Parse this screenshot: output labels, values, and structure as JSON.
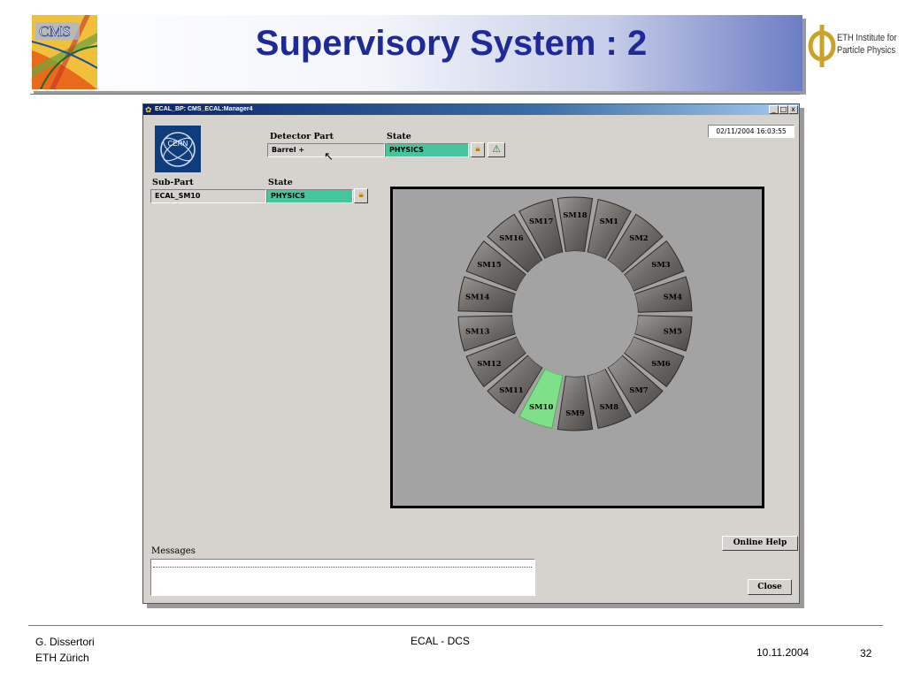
{
  "slide": {
    "title": "Supervisory System : 2",
    "cms_logo_text": "CMS",
    "eth_logo_line1": "ETH Institute for",
    "eth_logo_line2": "Particle Physics"
  },
  "window": {
    "title": "ECAL_BP: CMS_ECAL:Manager4",
    "controls": [
      "_",
      "□",
      "x"
    ],
    "cern_logo_text": "CERN",
    "datetime": "02/11/2004  16:03:55",
    "detector_part": {
      "label": "Detector Part",
      "value": "Barrel +"
    },
    "detector_state": {
      "label": "State",
      "value": "PHYSICS",
      "color": "#44c79e"
    },
    "subpart": {
      "label": "Sub-Part",
      "value": "ECAL_SM10"
    },
    "subpart_state": {
      "label": "State",
      "value": "PHYSICS",
      "color": "#44c79e"
    },
    "barrel": {
      "selected": "SM10",
      "selected_color": "#7fe08a",
      "sectors": [
        "SM1",
        "SM2",
        "SM3",
        "SM4",
        "SM5",
        "SM6",
        "SM7",
        "SM8",
        "SM9",
        "SM10",
        "SM11",
        "SM12",
        "SM13",
        "SM14",
        "SM15",
        "SM16",
        "SM17",
        "SM18"
      ]
    },
    "messages_label": "Messages",
    "online_help_label": "Online Help",
    "close_label": "Close"
  },
  "footer": {
    "author": "G. Dissertori",
    "institution": "ETH Zürich",
    "center": "ECAL - DCS",
    "date": "10.11.2004",
    "page": "32"
  }
}
